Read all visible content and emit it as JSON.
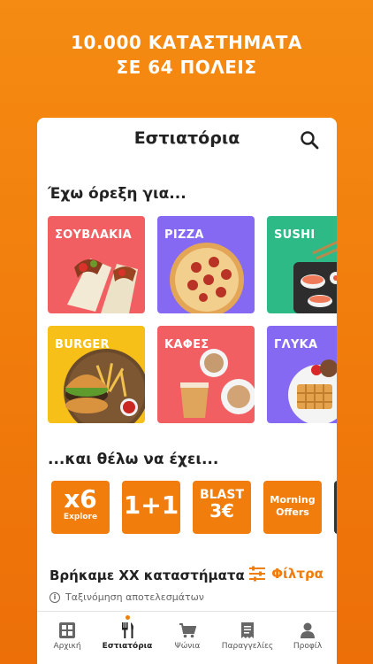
{
  "hero": {
    "line1": "10.000 ΚΑΤΑΣΤΗΜΑΤΑ",
    "line2": "ΣΕ 64 ΠΟΛΕΙΣ"
  },
  "header": {
    "title": "Εστιατόρια",
    "search_icon": "search-icon"
  },
  "categories_title": "Έχω όρεξη για...",
  "categories": [
    {
      "label": "ΣΟΥΒΛΑΚΙΑ",
      "color": "#f25f62"
    },
    {
      "label": "PIZZA",
      "color": "#8569f2"
    },
    {
      "label": "SUSHI",
      "color": "#2dba86"
    },
    {
      "label": "BURGER",
      "color": "#f6c019"
    },
    {
      "label": "ΚΑΦΕΣ",
      "color": "#f25f62"
    },
    {
      "label": "ΓΛΥΚΑ",
      "color": "#8569f2"
    }
  ],
  "offers_title": "...και θέλω να έχει...",
  "offers": [
    {
      "big": "x6",
      "small": "Explore"
    },
    {
      "big": "1+1",
      "small": ""
    },
    {
      "top": "BLAST",
      "price": "3€"
    },
    {
      "line1": "Morning",
      "line2": "Offers"
    }
  ],
  "results": {
    "found_text": "Βρήκαμε XX καταστήματα",
    "filters_label": "Φίλτρα",
    "sort_label": "Ταξινόμηση αποτελεσμάτων"
  },
  "tabbar": [
    {
      "label": "Αρχική",
      "icon": "box-logo-icon"
    },
    {
      "label": "Εστιατόρια",
      "icon": "cutlery-icon",
      "active": true
    },
    {
      "label": "Ψώνια",
      "icon": "cart-icon"
    },
    {
      "label": "Παραγγελίες",
      "icon": "receipt-icon"
    },
    {
      "label": "Προφίλ",
      "icon": "user-icon"
    }
  ],
  "colors": {
    "accent": "#f07d0c",
    "background": "#f58b12"
  }
}
